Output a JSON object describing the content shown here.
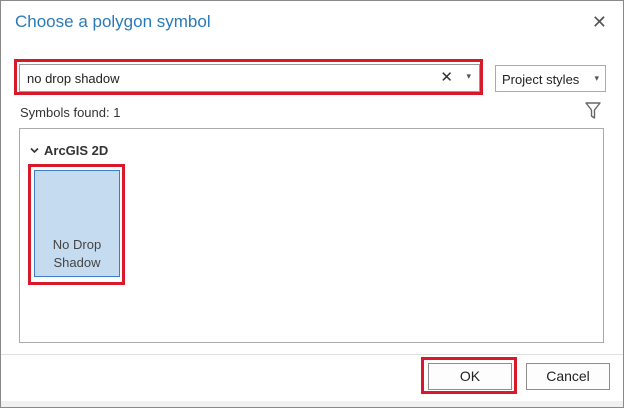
{
  "dialog": {
    "title": "Choose a polygon symbol",
    "close_icon": "close-icon"
  },
  "search": {
    "value": "no drop shadow",
    "clear_glyph": "✕",
    "dropdown_glyph": "▾"
  },
  "styles_dropdown": {
    "label": "Project styles",
    "caret": "▾"
  },
  "results": {
    "count_text": "Symbols found: 1"
  },
  "gallery": {
    "group_label": "ArcGIS 2D",
    "symbols": [
      {
        "line1": "No Drop",
        "line2": "Shadow"
      }
    ]
  },
  "buttons": {
    "ok": "OK",
    "cancel": "Cancel"
  },
  "colors": {
    "title": "#2a7ab8",
    "highlight": "#d7192a",
    "tile_fill": "#c5dcf0",
    "tile_border": "#3e7fc1"
  }
}
